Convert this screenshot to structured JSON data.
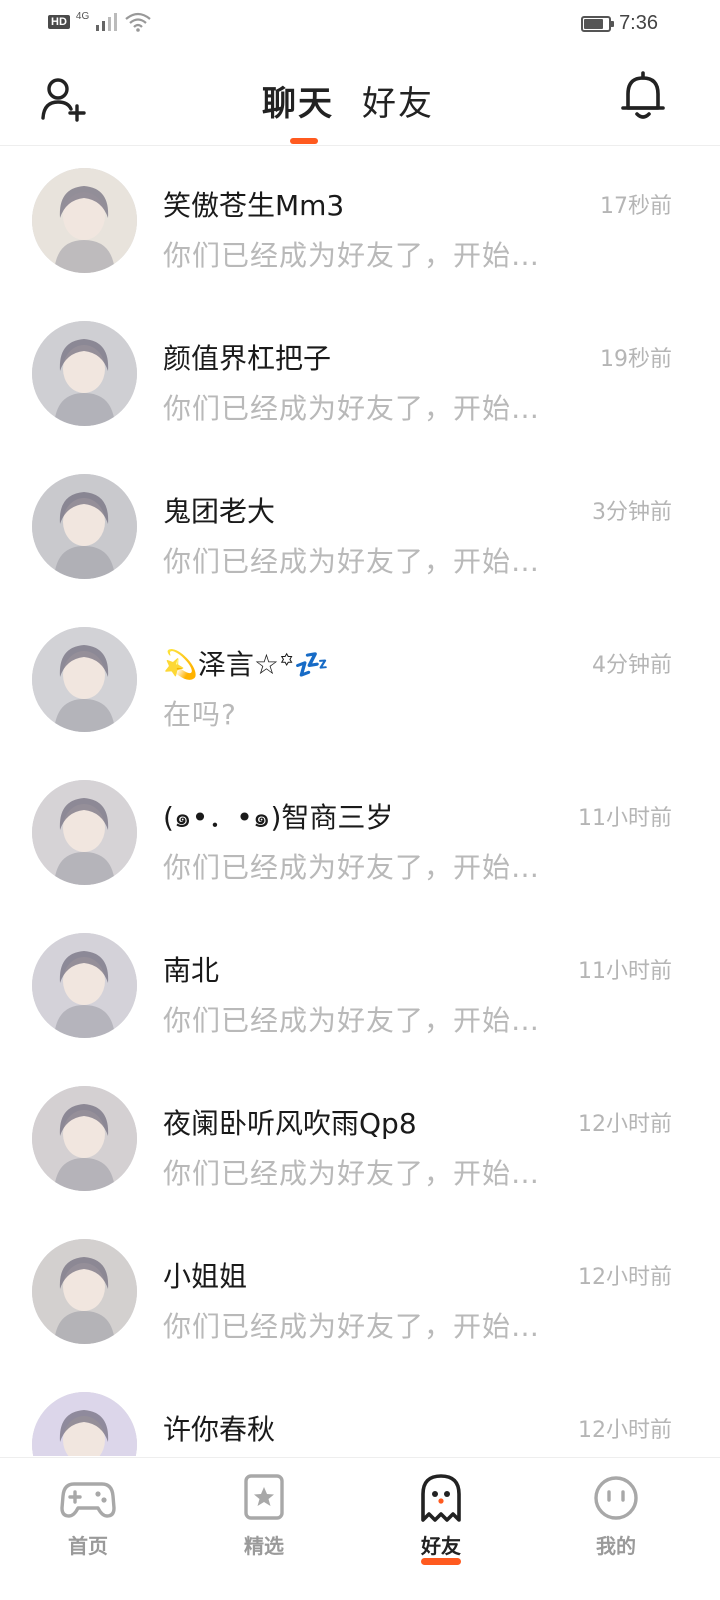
{
  "status_bar": {
    "hd": "HD",
    "network": "4G",
    "time": "7:36",
    "battery_level": 0.8
  },
  "header": {
    "tabs": [
      {
        "label": "聊天",
        "active": true
      },
      {
        "label": "好友",
        "active": false
      }
    ],
    "left_icon": "add-user-icon",
    "right_icon": "bell-icon",
    "accent_color": "#ff5a1f"
  },
  "chats": [
    {
      "name": "笑傲苍生Mm3",
      "time": "17秒前",
      "message": "你们已经成为好友了，开始…",
      "avatar_color": "#e8e3dc"
    },
    {
      "name": "颜值界杠把子",
      "time": "19秒前",
      "message": "你们已经成为好友了，开始…",
      "avatar_color": "#cfcfd3"
    },
    {
      "name": "鬼团老大",
      "time": "3分钟前",
      "message": "你们已经成为好友了，开始…",
      "avatar_color": "#c9c9cd"
    },
    {
      "name": "💫泽言☆꙳💤",
      "time": "4分钟前",
      "message": "在吗?",
      "avatar_color": "#d2d2d6"
    },
    {
      "name": "(๑•．•๑)智商三岁",
      "time": "11小时前",
      "message": "你们已经成为好友了，开始…",
      "avatar_color": "#d6d3d6"
    },
    {
      "name": "南北",
      "time": "11小时前",
      "message": "你们已经成为好友了，开始…",
      "avatar_color": "#d4d2d9"
    },
    {
      "name": "夜阑卧听风吹雨Qp8",
      "time": "12小时前",
      "message": "你们已经成为好友了，开始…",
      "avatar_color": "#d4d0d2"
    },
    {
      "name": "小姐姐",
      "time": "12小时前",
      "message": "你们已经成为好友了，开始…",
      "avatar_color": "#d3d0cf"
    },
    {
      "name": "许你春秋",
      "time": "12小时前",
      "message": "",
      "avatar_color": "#dcd6ea"
    }
  ],
  "bottom_nav": [
    {
      "label": "首页",
      "icon": "gamepad-icon",
      "active": false
    },
    {
      "label": "精选",
      "icon": "star-card-icon",
      "active": false
    },
    {
      "label": "好友",
      "icon": "ghost-icon",
      "active": true
    },
    {
      "label": "我的",
      "icon": "face-icon",
      "active": false
    }
  ]
}
